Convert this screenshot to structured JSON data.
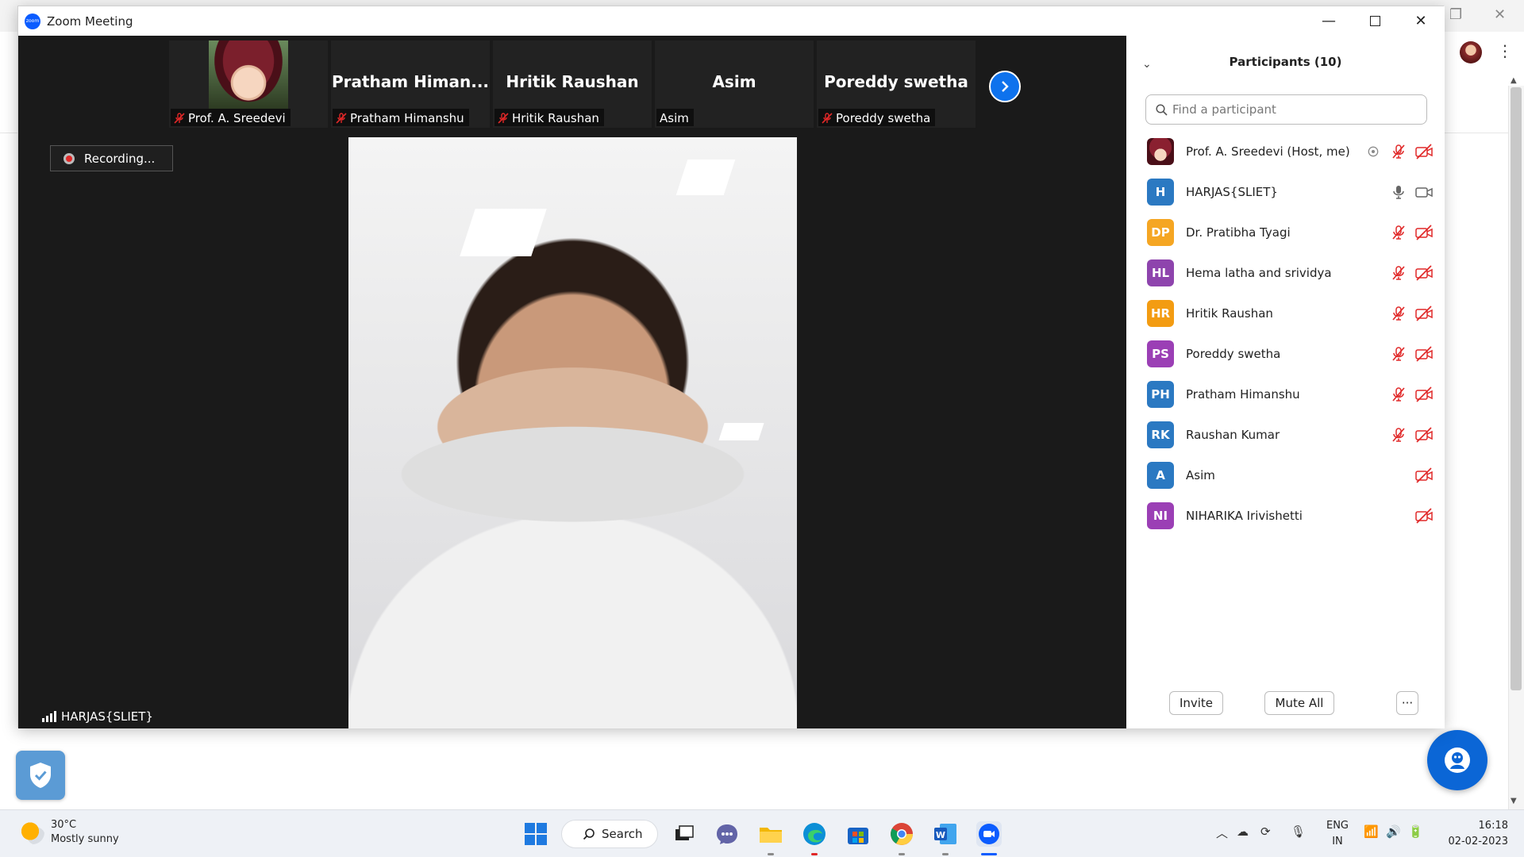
{
  "window": {
    "title": "Zoom Meeting",
    "logo_text": "zoom"
  },
  "recording": {
    "label": "Recording..."
  },
  "strip": [
    {
      "big_name": "",
      "label": "Prof. A. Sreedevi",
      "photo": true,
      "muted": true
    },
    {
      "big_name": "Pratham  Himan...",
      "label": "Pratham Himanshu",
      "photo": false,
      "muted": true
    },
    {
      "big_name": "Hritik Raushan",
      "label": "Hritik Raushan",
      "photo": false,
      "muted": true
    },
    {
      "big_name": "Asim",
      "label": "Asim",
      "photo": false,
      "muted": false
    },
    {
      "big_name": "Poreddy swetha",
      "label": "Poreddy swetha",
      "photo": false,
      "muted": true
    }
  ],
  "main_video": {
    "name": "HARJAS{SLIET}"
  },
  "panel": {
    "title": "Participants (10)",
    "search_placeholder": "Find a participant",
    "participants": [
      {
        "initials": "",
        "photo": true,
        "name": "Prof. A. Sreedevi (Host, me)",
        "color": "#ffffff",
        "mic": "muted",
        "video": "off",
        "share": true
      },
      {
        "initials": "H",
        "name": "HARJAS{SLIET}",
        "color": "#2b79c2",
        "mic": "on",
        "video": "on"
      },
      {
        "initials": "DP",
        "name": "Dr. Pratibha Tyagi",
        "color": "#f5a623",
        "mic": "muted",
        "video": "off"
      },
      {
        "initials": "HL",
        "name": "Hema latha and srividya",
        "color": "#8e44ad",
        "mic": "muted",
        "video": "off"
      },
      {
        "initials": "HR",
        "name": "Hritik Raushan",
        "color": "#f39c12",
        "mic": "muted",
        "video": "off"
      },
      {
        "initials": "PS",
        "name": "Poreddy swetha",
        "color": "#9b3fb5",
        "mic": "muted",
        "video": "off"
      },
      {
        "initials": "PH",
        "name": "Pratham Himanshu",
        "color": "#2b79c2",
        "mic": "muted",
        "video": "off"
      },
      {
        "initials": "RK",
        "name": "Raushan Kumar",
        "color": "#2b79c2",
        "mic": "muted",
        "video": "off"
      },
      {
        "initials": "A",
        "name": "Asim",
        "color": "#2b79c2",
        "mic": "none",
        "video": "off"
      },
      {
        "initials": "NI",
        "name": "NIHARIKA Irivishetti",
        "color": "#9b3fb5",
        "mic": "none",
        "video": "off"
      }
    ],
    "invite_label": "Invite",
    "mute_all_label": "Mute All",
    "more_label": "···"
  },
  "taskbar": {
    "temperature": "30°C",
    "condition": "Mostly sunny",
    "search_label": "Search",
    "lang_line1": "ENG",
    "lang_line2": "IN",
    "time": "16:18",
    "date": "02-02-2023"
  },
  "colors": {
    "zoom_blue": "#0e72ed",
    "mute_red": "#e02828",
    "video_bg": "#1a1a1a"
  }
}
